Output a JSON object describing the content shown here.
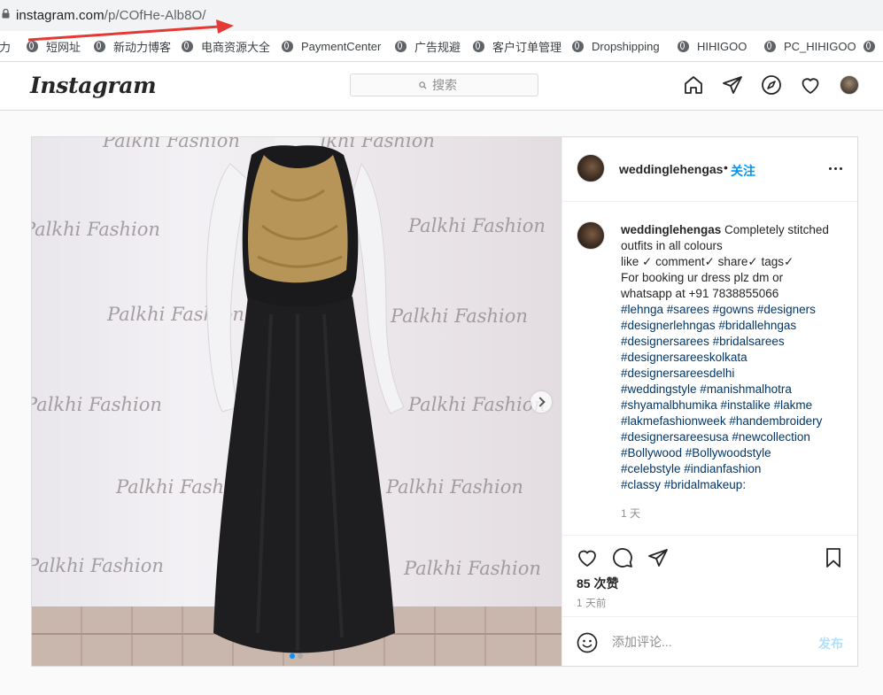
{
  "browser": {
    "url_host": "instagram.com",
    "url_path": "/p/COfHe-Alb8O/",
    "bookmarks": [
      {
        "label": "动力",
        "icon": "globe-icon"
      },
      {
        "label": "短网址",
        "icon": "globe-icon"
      },
      {
        "label": "新动力博客",
        "icon": "globe-icon"
      },
      {
        "label": "电商资源大全",
        "icon": "globe-icon"
      },
      {
        "label": "PaymentCenter",
        "icon": "globe-icon"
      },
      {
        "label": "广告规避",
        "icon": "globe-icon"
      },
      {
        "label": "客户订单管理",
        "icon": "globe-icon"
      },
      {
        "label": "Dropshipping",
        "icon": "globe-icon"
      },
      {
        "label": "HIHIGOO",
        "icon": "globe-icon"
      },
      {
        "label": "PC_HIHIGOO",
        "icon": "globe-icon"
      }
    ]
  },
  "header": {
    "logo": "Instagram",
    "search_placeholder": "搜索",
    "icons": [
      "home-icon",
      "direct-icon",
      "explore-icon",
      "activity-heart-icon",
      "profile-avatar"
    ]
  },
  "post": {
    "username": "weddinglehengas",
    "separator": "•",
    "follow_label": "关注",
    "image_watermark": "Palkhi Fashion",
    "carousel": {
      "count": 2,
      "active": 1
    },
    "caption_lines": [
      {
        "text": "Completely stitched",
        "type": "first"
      },
      {
        "text": "outfits in all colours",
        "type": "text"
      },
      {
        "text": "like ✓ comment✓ share✓ tags✓",
        "type": "text"
      },
      {
        "text": "For booking ur dress plz dm or",
        "type": "text"
      },
      {
        "text": "whatsapp at +91 7838855066",
        "type": "text"
      },
      {
        "text": "#lehnga #sarees #gowns #designers",
        "type": "tag"
      },
      {
        "text": "#designerlehngas #bridallehngas",
        "type": "tag"
      },
      {
        "text": "#designersarees #bridalsarees",
        "type": "tag"
      },
      {
        "text": "#designersareeskolkata",
        "type": "tag"
      },
      {
        "text": "#designersareesdelhi",
        "type": "tag"
      },
      {
        "text": "#weddingstyle #manishmalhotra",
        "type": "tag"
      },
      {
        "text": "#shyamalbhumika #instalike #lakme",
        "type": "tag"
      },
      {
        "text": "#lakmefashionweek #handembroidery",
        "type": "tag"
      },
      {
        "text": "#designersareesusa #newcollection",
        "type": "tag"
      },
      {
        "text": "#Bollywood #Bollywoodstyle",
        "type": "tag"
      },
      {
        "text": "#celebstyle #indianfashion",
        "type": "tag"
      },
      {
        "text": "#classy #bridalmakeup:",
        "type": "tag"
      }
    ],
    "caption_time": "1 天",
    "likes": "85 次赞",
    "post_time": "1 天前",
    "comment_placeholder": "添加评论...",
    "post_button": "发布",
    "colors": {
      "link_blue": "#0095f6",
      "hashtag": "#00376b",
      "post_disabled": "#b2dffc"
    }
  }
}
